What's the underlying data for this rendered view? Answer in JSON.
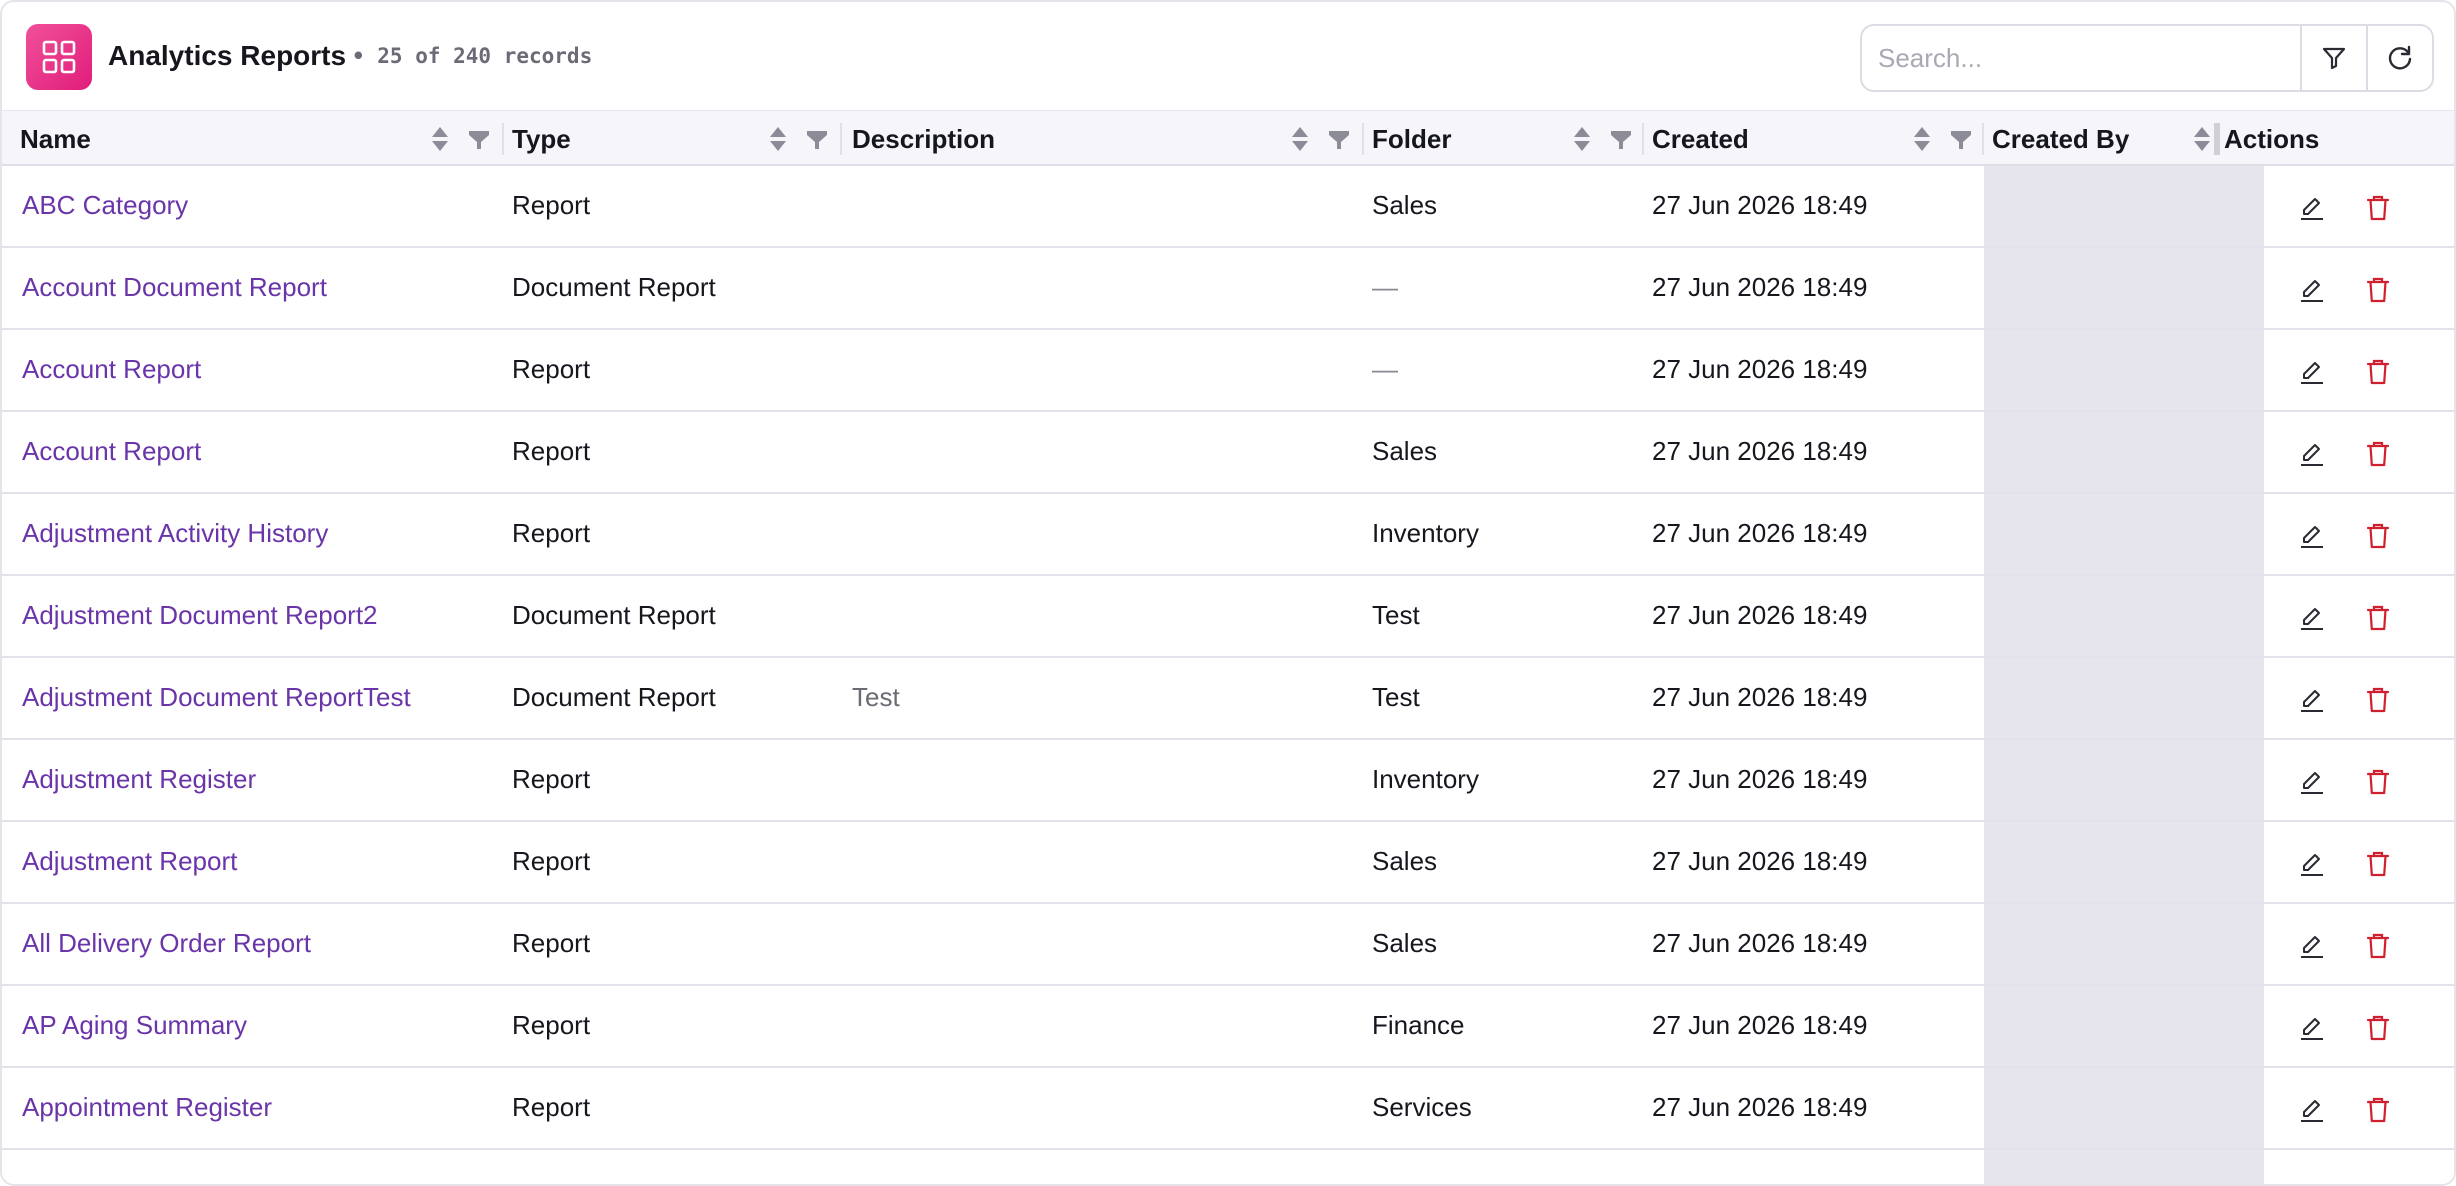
{
  "header": {
    "title": "Analytics Reports",
    "record_count": "• 25 of 240 records",
    "icon": "grid-icon"
  },
  "search": {
    "placeholder": "Search...",
    "value": ""
  },
  "toolbar": {
    "filter_icon": "filter-icon",
    "refresh_icon": "refresh-icon"
  },
  "columns": {
    "name": "Name",
    "type": "Type",
    "description": "Description",
    "folder": "Folder",
    "created": "Created",
    "created_by": "Created By",
    "actions": "Actions"
  },
  "rows": [
    {
      "name": "ABC Category",
      "type": "Report",
      "description": "",
      "folder": "Sales",
      "created": "27 Jun 2026 18:49",
      "created_by": ""
    },
    {
      "name": "Account Document Report",
      "type": "Document Report",
      "description": "",
      "folder": "—",
      "created": "27 Jun 2026 18:49",
      "created_by": ""
    },
    {
      "name": "Account Report",
      "type": "Report",
      "description": "",
      "folder": "—",
      "created": "27 Jun 2026 18:49",
      "created_by": ""
    },
    {
      "name": "Account Report",
      "type": "Report",
      "description": "",
      "folder": "Sales",
      "created": "27 Jun 2026 18:49",
      "created_by": ""
    },
    {
      "name": "Adjustment Activity History",
      "type": "Report",
      "description": "",
      "folder": "Inventory",
      "created": "27 Jun 2026 18:49",
      "created_by": ""
    },
    {
      "name": "Adjustment Document Report2",
      "type": "Document Report",
      "description": "",
      "folder": "Test",
      "created": "27 Jun 2026 18:49",
      "created_by": ""
    },
    {
      "name": "Adjustment Document ReportTest",
      "type": "Document Report",
      "description": "Test",
      "folder": "Test",
      "created": "27 Jun 2026 18:49",
      "created_by": ""
    },
    {
      "name": "Adjustment Register",
      "type": "Report",
      "description": "",
      "folder": "Inventory",
      "created": "27 Jun 2026 18:49",
      "created_by": ""
    },
    {
      "name": "Adjustment Report",
      "type": "Report",
      "description": "",
      "folder": "Sales",
      "created": "27 Jun 2026 18:49",
      "created_by": ""
    },
    {
      "name": "All Delivery Order Report",
      "type": "Report",
      "description": "",
      "folder": "Sales",
      "created": "27 Jun 2026 18:49",
      "created_by": ""
    },
    {
      "name": "AP Aging Summary",
      "type": "Report",
      "description": "",
      "folder": "Finance",
      "created": "27 Jun 2026 18:49",
      "created_by": ""
    },
    {
      "name": "Appointment Register",
      "type": "Report",
      "description": "",
      "folder": "Services",
      "created": "27 Jun 2026 18:49",
      "created_by": ""
    }
  ],
  "actions": {
    "edit_icon": "edit-icon",
    "delete_icon": "delete-icon"
  },
  "colors": {
    "accent": "#e11d7a",
    "link": "#6a35a8",
    "delete": "#d0202f"
  }
}
